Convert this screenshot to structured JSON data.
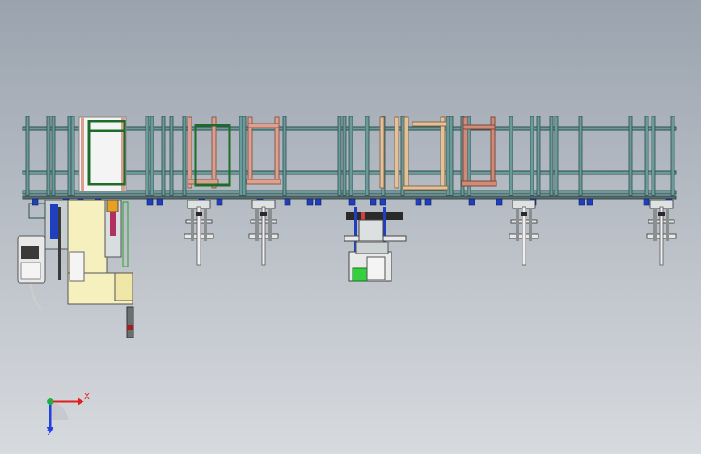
{
  "viewport": {
    "background_top": "#9aa3ae",
    "background_bottom": "#d7dade"
  },
  "colors": {
    "frame": "#5f8f8f",
    "frame_dark": "#2f4f4f",
    "fixture_pink": "#d9a08f",
    "fixture_green": "#1f6b2a",
    "fixture_tan": "#d8b98a",
    "fixture_salmon": "#c98b78",
    "cabinet_yellow": "#f3ecb8",
    "blue_parts": "#1f3fbf",
    "axis_x": "#e02020",
    "axis_y": "#20b040",
    "axis_z": "#2040e0"
  },
  "triad": {
    "x_label": "X",
    "z_label": "Z"
  }
}
